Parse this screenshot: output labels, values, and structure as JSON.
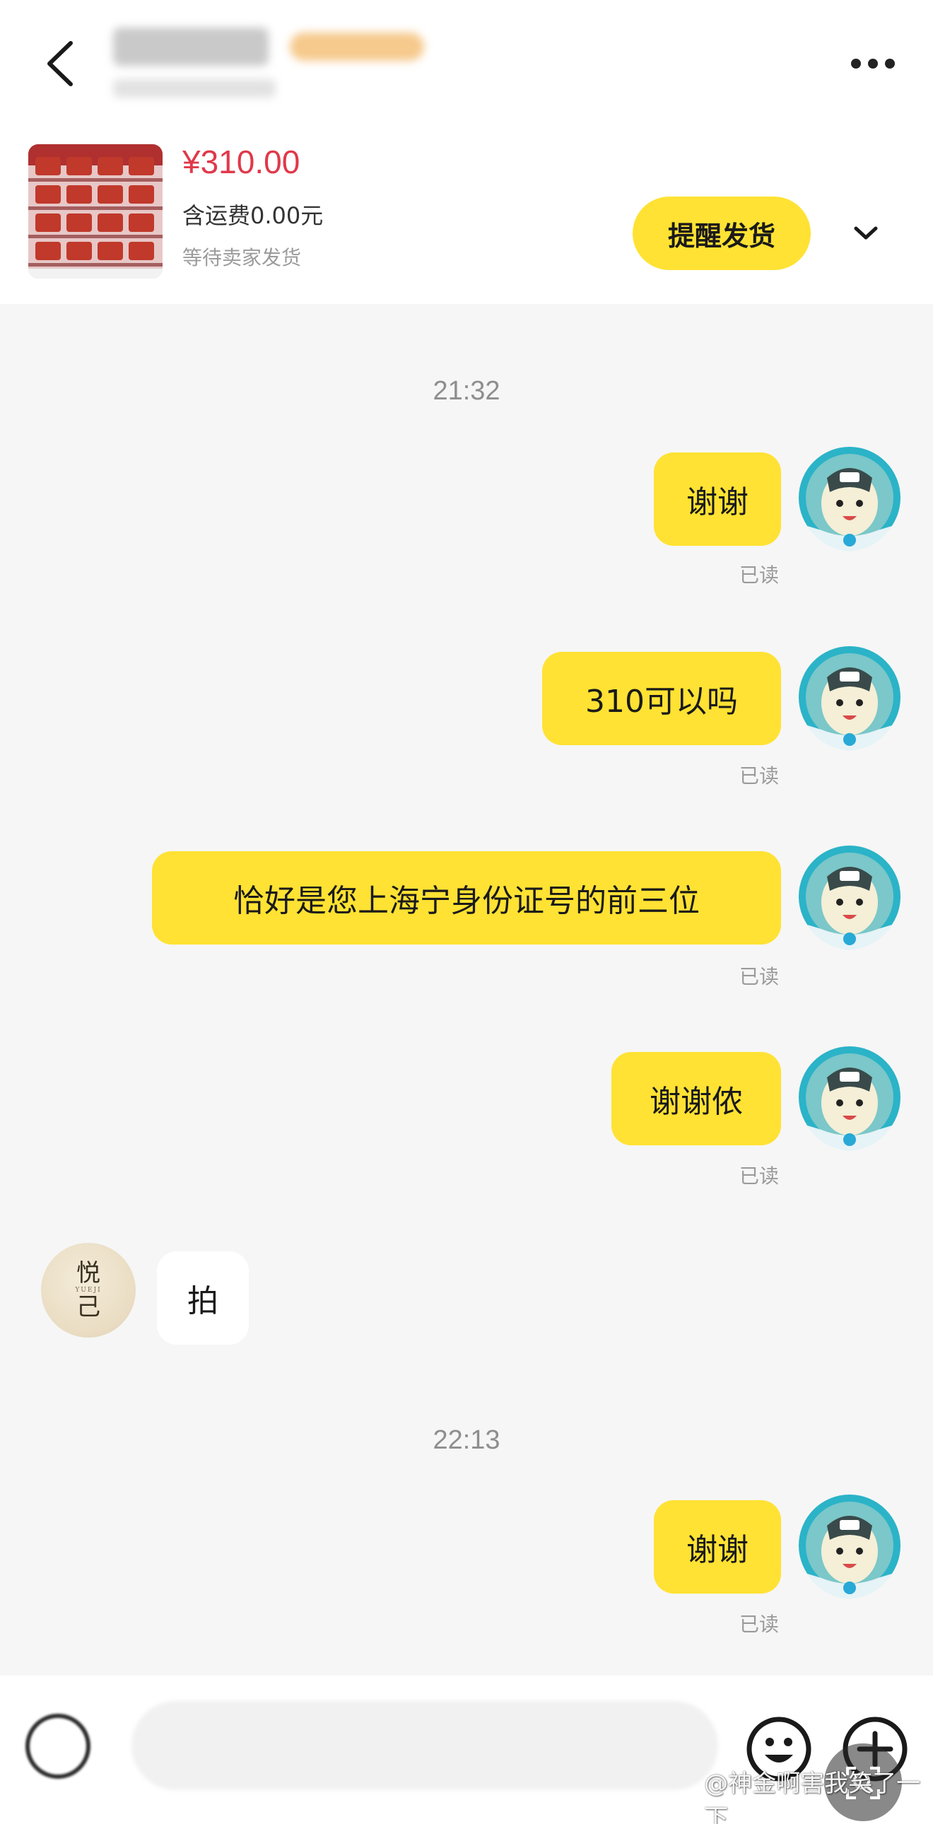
{
  "header": {
    "back_icon": "chevron-left-icon",
    "more_icon": "more-dots-icon"
  },
  "product": {
    "price": "¥310.00",
    "shipping": "含运费0.00元",
    "status": "等待卖家发货",
    "remind_label": "提醒发货",
    "expand_icon": "chevron-down-icon"
  },
  "chat": {
    "time_1": "21:32",
    "time_2": "22:13",
    "read_label": "已读",
    "messages": [
      {
        "from": "me",
        "text": "谢谢"
      },
      {
        "from": "me",
        "text": "310可以吗"
      },
      {
        "from": "me",
        "text": "恰好是您上海宁身份证号的前三位"
      },
      {
        "from": "me",
        "text": "谢谢侬"
      },
      {
        "from": "seller",
        "text": "拍"
      },
      {
        "from": "me",
        "text": "谢谢"
      }
    ],
    "seller_avatar": {
      "top": "悦",
      "small": "YUEJI",
      "bottom": "己"
    }
  },
  "input_bar": {
    "voice_icon": "voice-icon",
    "emoji_icon": "emoji-icon",
    "plus_icon": "plus-icon"
  },
  "watermark": {
    "text": "@神金啊害我笑了一下"
  },
  "colors": {
    "accent": "#ffe233",
    "price": "#e0394a",
    "timestamp": "#8e8e8e"
  }
}
